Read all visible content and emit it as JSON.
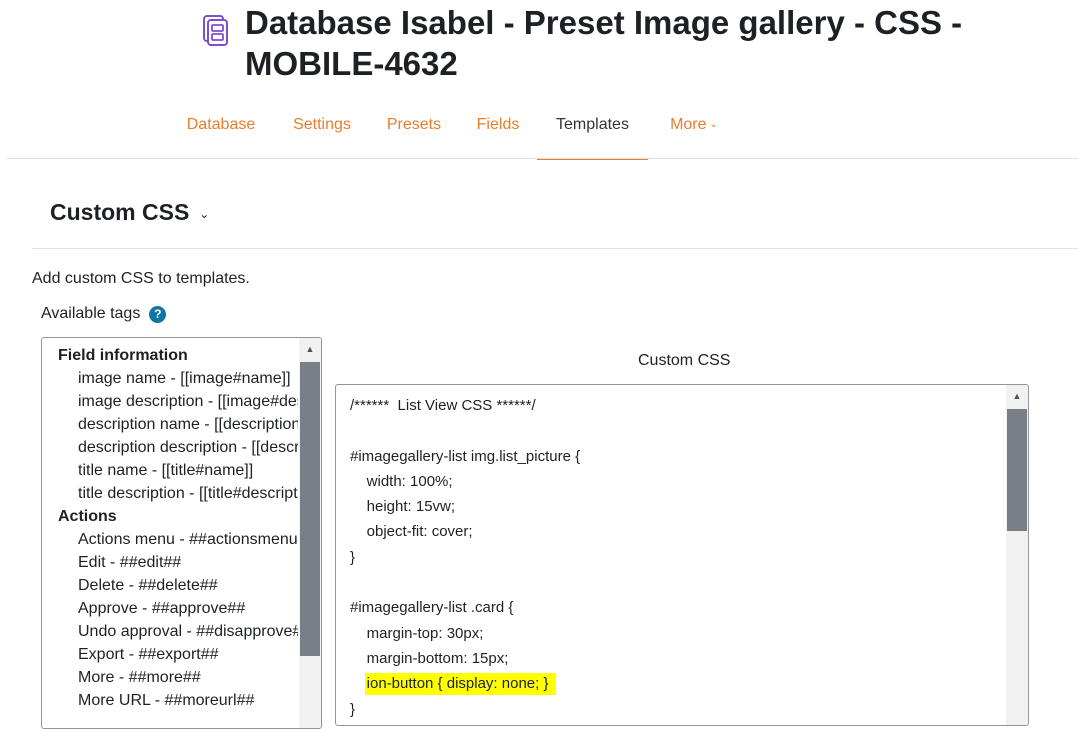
{
  "page": {
    "title": "Database Isabel - Preset Image gallery - CSS - MOBILE-4632",
    "icon": "database-icon"
  },
  "tabs": [
    {
      "label": "Database",
      "active": false
    },
    {
      "label": "Settings",
      "active": false
    },
    {
      "label": "Presets",
      "active": false
    },
    {
      "label": "Fields",
      "active": false
    },
    {
      "label": "Templates",
      "active": true
    },
    {
      "label": "More",
      "active": false,
      "icon": "chevron-down-icon"
    }
  ],
  "section": {
    "title": "Custom CSS",
    "icon": "chevron-down-icon"
  },
  "intro": "Add custom CSS to templates.",
  "available_tags": {
    "label": "Available tags",
    "help_icon": "?",
    "groups": [
      {
        "title": "Field information",
        "items": [
          "image name - [[image#name]]",
          "image description - [[image#description]]",
          "description name - [[description#name]]",
          "description description - [[description#description]]",
          "title name - [[title#name]]",
          "title description - [[title#description]]"
        ]
      },
      {
        "title": "Actions",
        "items": [
          "Actions menu - ##actionsmenu##",
          "Edit - ##edit##",
          "Delete - ##delete##",
          "Approve - ##approve##",
          "Undo approval - ##disapprove##",
          "Export - ##export##",
          "More - ##more##",
          "More URL - ##moreurl##"
        ]
      }
    ],
    "scroll_fraction": 0.74
  },
  "editor": {
    "label": "Custom CSS",
    "lines": [
      "/******  List View CSS ******/",
      "",
      "#imagegallery-list img.list_picture {",
      "    width: 100%;",
      "    height: 15vw;",
      "    object-fit: cover;",
      "}",
      "",
      "#imagegallery-list .card {",
      "    margin-top: 30px;",
      "    margin-bottom: 15px;",
      "    ion-button { display: none; }",
      "}"
    ],
    "highlight_line": 11,
    "highlight_color": "#ffff00",
    "scroll_fraction": 0.36
  },
  "colors": {
    "accent": "#ea7d2b",
    "help": "#1177a0",
    "icon": "#7c4fd1"
  }
}
